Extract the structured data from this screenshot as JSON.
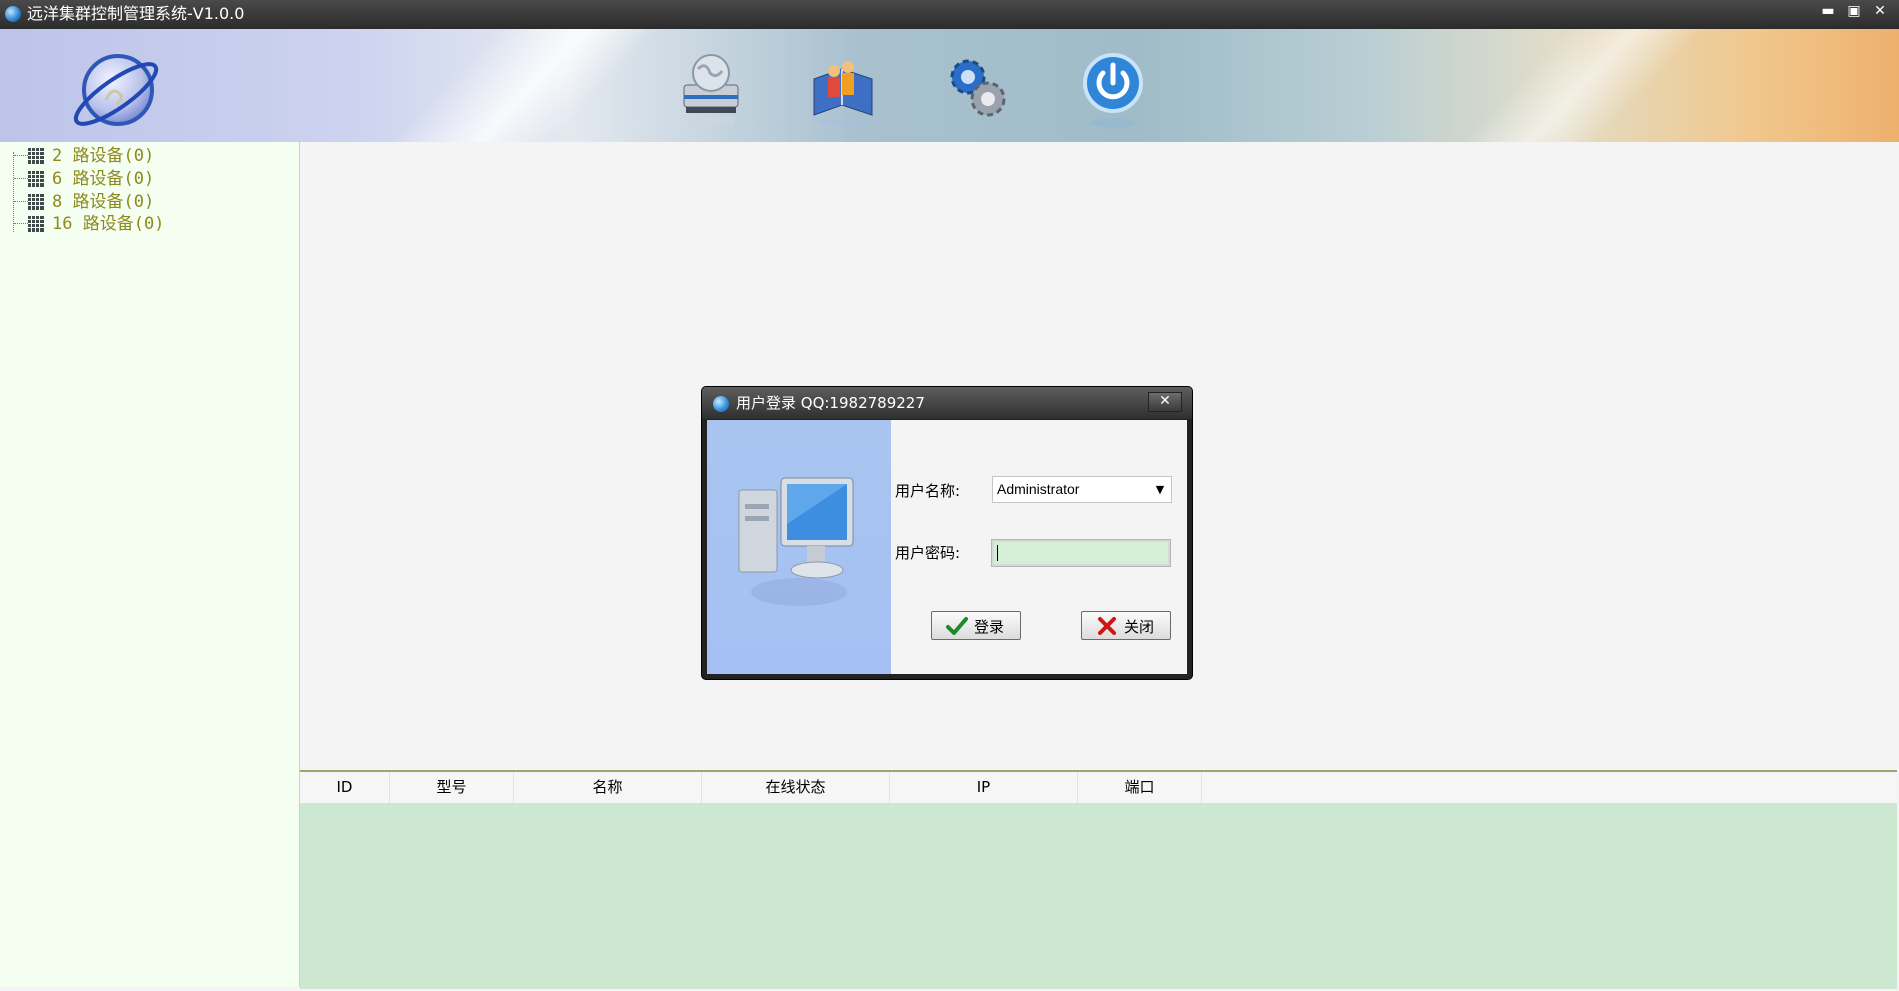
{
  "window": {
    "title": "远洋集群控制管理系统-V1.0.0",
    "controls": {
      "minimize": "▬",
      "maximize": "▣",
      "close": "✕"
    }
  },
  "toolbar": {
    "icons": [
      "server-globe-icon",
      "users-book-icon",
      "settings-gears-icon",
      "power-icon"
    ]
  },
  "sidebar": {
    "items": [
      {
        "label": "2 路设备(0)"
      },
      {
        "label": "6 路设备(0)"
      },
      {
        "label": "8 路设备(0)"
      },
      {
        "label": "16 路设备(0)"
      }
    ]
  },
  "table": {
    "columns": [
      "ID",
      "型号",
      "名称",
      "在线状态",
      "IP",
      "端口"
    ],
    "rows": []
  },
  "login_dialog": {
    "title": "用户登录 QQ:1982789227",
    "close_label": "✕",
    "username_label": "用户名称:",
    "username_value": "Administrator",
    "password_label": "用户密码:",
    "password_value": "",
    "login_button": "登录",
    "cancel_button": "关闭"
  },
  "colors": {
    "sidebar_bg": "#f5fff1",
    "tree_text": "#8d8a1d",
    "table_bg": "#cde8d0",
    "dialog_side": "#a8c5ef",
    "password_bg": "#d3efd5"
  }
}
